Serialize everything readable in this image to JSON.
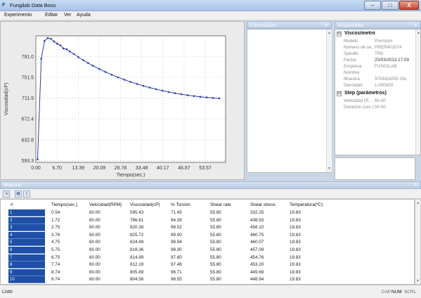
{
  "window": {
    "icon_text": "F",
    "title": "Fungilab Data Boss",
    "buttons": {
      "minimize": "–",
      "maximize": "□",
      "close": "X"
    }
  },
  "menu": [
    "Experimento",
    "Editar",
    "Ver",
    "Ayuda"
  ],
  "chart_data": {
    "type": "line",
    "xlabel": "Tiempo(sec.)",
    "ylabel": "Viscosidad(cP)",
    "x_ticks": [
      "0.00",
      "6.70",
      "13.39",
      "20.09",
      "26.78",
      "33.48",
      "40.17",
      "46.87",
      "53.57"
    ],
    "y_ticks": [
      "593.3",
      "632.8",
      "672.4",
      "711.9",
      "751.5",
      "791.0"
    ],
    "xlim": [
      0,
      60
    ],
    "ylim": [
      590,
      830
    ],
    "grid": true,
    "series_color": "#2b3fa8",
    "series": [
      {
        "x": [
          0.54,
          1.72,
          2.75,
          3.76,
          4.75,
          5.75,
          6.75,
          7.74,
          8.74,
          9.74,
          10.73,
          12,
          13.5,
          15,
          16.5,
          18,
          20,
          22,
          24,
          26,
          28,
          30,
          32,
          34,
          36,
          38,
          40,
          42,
          44,
          46,
          48,
          50,
          52,
          54,
          56,
          58
        ],
        "y": [
          595.43,
          786.61,
          820.38,
          825.72,
          824.49,
          819.36,
          814.99,
          812.19,
          805.89,
          804.56,
          800.4,
          795.5,
          789.5,
          783.8,
          778.4,
          773.4,
          767.2,
          761.5,
          756.2,
          751.3,
          746.8,
          742.6,
          738.7,
          735.1,
          731.8,
          728.8,
          726.0,
          723.5,
          721.2,
          719.2,
          717.4,
          715.8,
          714.4,
          713.2,
          712.2,
          711.4
        ]
      }
    ]
  },
  "comments_panel": {
    "title": "Comentarios"
  },
  "properties_panel": {
    "title": "Propiedades",
    "groups": [
      {
        "label": "Viscosímetro",
        "toggle": "⊟",
        "rows": [
          {
            "key": "Modelo",
            "value": "Premium"
          },
          {
            "key": "Número de se...",
            "value": "PRER401074"
          },
          {
            "key": "Spindle",
            "value": "TR8"
          },
          {
            "key": "Fecha",
            "value": "25/03/2013 17:09"
          },
          {
            "key": "Empresa",
            "value": "FUNGILAB"
          },
          {
            "key": "Nombre",
            "value": ""
          },
          {
            "key": "Muestra",
            "value": "STANDARD OIL"
          },
          {
            "key": "Densidad",
            "value": "1.000000"
          }
        ]
      },
      {
        "label": "Step (parámetros)",
        "toggle": "⊟",
        "rows": [
          {
            "key": "Velocidad (R...",
            "value": "60.00"
          },
          {
            "key": "Duración (sec.)",
            "value": "50.00"
          }
        ]
      }
    ]
  },
  "samples_panel": {
    "title": "Muestras",
    "columns": [
      "#",
      "Tiempo(sec.)",
      "Velocidad(RPM)",
      "Viscosidad(cP)",
      "% Torsión",
      "Shear rate",
      "Shear stress",
      "Temperatura(ºC)"
    ],
    "rows": [
      [
        "1",
        "0.54",
        "60.00",
        "595.43",
        "71.45",
        "55.80",
        "332.25",
        "19.83"
      ],
      [
        "2",
        "1.72",
        "60.00",
        "786.61",
        "94.39",
        "55.80",
        "438.93",
        "19.83"
      ],
      [
        "3",
        "2.75",
        "60.00",
        "820.38",
        "98.52",
        "55.80",
        "458.10",
        "19.83"
      ],
      [
        "4",
        "3.76",
        "60.00",
        "825.72",
        "99.00",
        "55.80",
        "460.75",
        "19.83"
      ],
      [
        "5",
        "4.75",
        "60.00",
        "824.49",
        "98.94",
        "55.80",
        "460.07",
        "19.83"
      ],
      [
        "6",
        "5.75",
        "60.00",
        "819.36",
        "98.30",
        "55.80",
        "457.09",
        "19.83"
      ],
      [
        "7",
        "6.75",
        "60.00",
        "814.99",
        "97.80",
        "55.80",
        "454.76",
        "19.83"
      ],
      [
        "8",
        "7.74",
        "60.00",
        "812.19",
        "97.46",
        "55.80",
        "453.20",
        "19.83"
      ],
      [
        "9",
        "8.74",
        "60.00",
        "805.89",
        "96.71",
        "55.80",
        "449.69",
        "19.83"
      ],
      [
        "10",
        "9.74",
        "60.00",
        "804.56",
        "96.55",
        "55.80",
        "448.94",
        "19.83"
      ]
    ]
  },
  "status": {
    "text": "Listo",
    "indicators": [
      "CAP",
      "NUM",
      "SCRL"
    ]
  }
}
